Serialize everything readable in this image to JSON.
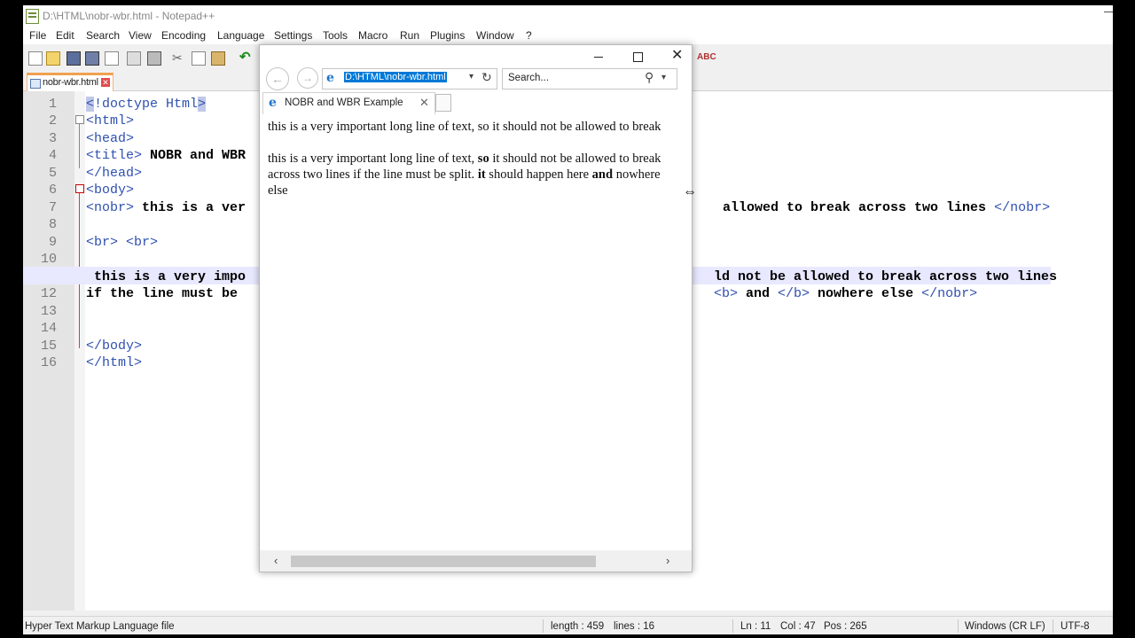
{
  "notepad": {
    "title": "D:\\HTML\\nobr-wbr.html - Notepad++",
    "menu": [
      "File",
      "Edit",
      "Search",
      "View",
      "Encoding",
      "Language",
      "Settings",
      "Tools",
      "Macro",
      "Run",
      "Plugins",
      "Window",
      "?"
    ],
    "tab_label": "nobr-wbr.html",
    "line_numbers": [
      "1",
      "2",
      "3",
      "4",
      "5",
      "6",
      "7",
      "8",
      "9",
      "10",
      "11",
      "12",
      "13",
      "14",
      "15",
      "16"
    ],
    "code": {
      "l1_a": "<",
      "l1_b": "!doctype Html",
      "l1_c": ">",
      "l2": "<html>",
      "l3": "<head>",
      "l4_tag": "<title>",
      "l4_text": " NOBR and WBR",
      "l5": "</head>",
      "l6": "<body>",
      "l7_tag": "<nobr>",
      "l7_text": " this is a ver",
      "l7_tail_text": "allowed to break across two lines ",
      "l7_tail_tag": "</nobr>",
      "l9": "<br> <br>",
      "l11_text": " this is a very impo",
      "l11_tail": "ld not be allowed to break across two lines",
      "l12_text": "if the line must be ",
      "l12_tail_tag1": "<b>",
      "l12_tail_text1": " and ",
      "l12_tail_tag2": "</b>",
      "l12_tail_text2": " nowhere else ",
      "l12_tail_tag3": "</nobr>",
      "l15": "</body>",
      "l16": "</html>"
    },
    "status": {
      "filetype": "Hyper Text Markup Language file",
      "length": "length : 459",
      "lines": "lines : 16",
      "ln": "Ln : 11",
      "col": "Col : 47",
      "pos": "Pos : 265",
      "eol": "Windows (CR LF)",
      "encoding": "UTF-8"
    }
  },
  "browser": {
    "url": "D:\\HTML\\nobr-wbr.html",
    "search_placeholder": "Search...",
    "tab_title": "NOBR and WBR Example",
    "content": {
      "p1": "this is a very important long line of text, so it should not be allowed to break",
      "p2_a": "this is a very important long line of text, ",
      "p2_b": "so",
      "p2_c": " it should not be allowed to break across two lines if the line must be split. ",
      "p2_d": "it",
      "p2_e": " should happen here ",
      "p2_f": "and",
      "p2_g": " nowhere else"
    }
  }
}
